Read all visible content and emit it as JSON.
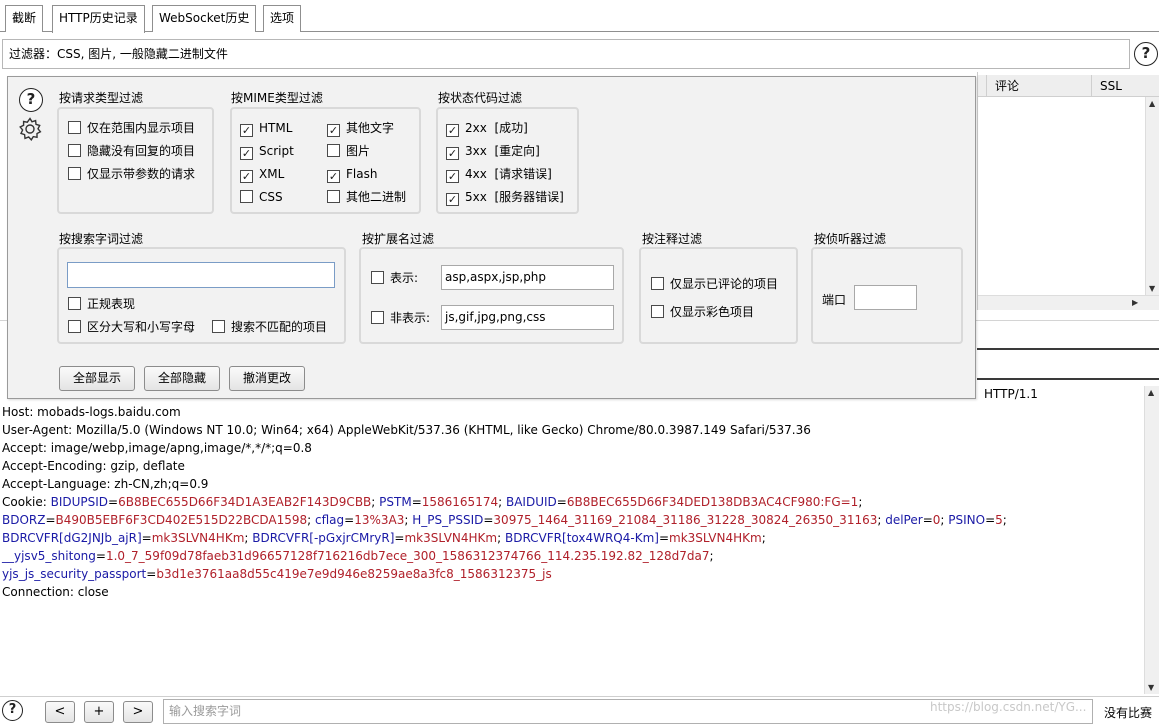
{
  "tabs": [
    "截断",
    "HTTP历史记录",
    "WebSocket历史",
    "选项"
  ],
  "filter_bar": {
    "text": "过滤器：CSS, 图片, 一般隐藏二进制文件"
  },
  "table_header": {
    "col_comment": "评论",
    "col_ssl": "SSL"
  },
  "popup": {
    "request_type": {
      "title": "按请求类型过滤",
      "options": [
        {
          "label": "仅在范围内显示项目",
          "checked": false
        },
        {
          "label": "隐藏没有回复的项目",
          "checked": false
        },
        {
          "label": "仅显示带参数的请求",
          "checked": false
        }
      ]
    },
    "mime": {
      "title": "按MIME类型过滤",
      "options": [
        {
          "label": "HTML",
          "checked": true
        },
        {
          "label": "其他文字",
          "checked": true
        },
        {
          "label": "Script",
          "checked": true
        },
        {
          "label": "图片",
          "checked": false
        },
        {
          "label": "XML",
          "checked": true
        },
        {
          "label": "Flash",
          "checked": true
        },
        {
          "label": "CSS",
          "checked": false
        },
        {
          "label": "其他二进制",
          "checked": false
        }
      ]
    },
    "status": {
      "title": "按状态代码过滤",
      "options": [
        {
          "label": "2xx  [成功]",
          "checked": true
        },
        {
          "label": "3xx  [重定向]",
          "checked": true
        },
        {
          "label": "4xx  [请求错误]",
          "checked": true
        },
        {
          "label": "5xx  [服务器错误]",
          "checked": true
        }
      ]
    },
    "search": {
      "title": "按搜索字词过滤",
      "value": "",
      "regex": {
        "label": "正规表现",
        "checked": false
      },
      "case": {
        "label": "区分大写和小写字母",
        "checked": false
      },
      "negative": {
        "label": "搜索不匹配的项目",
        "checked": false
      }
    },
    "extension": {
      "title": "按扩展名过滤",
      "show_label": "表示:",
      "show_value": "asp,aspx,jsp,php",
      "hide_label": "非表示:",
      "hide_value": "js,gif,jpg,png,css"
    },
    "annotation": {
      "title": "按注释过滤",
      "commented": {
        "label": "仅显示已评论的项目",
        "checked": false
      },
      "highlighted": {
        "label": "仅显示彩色项目",
        "checked": false
      }
    },
    "listener": {
      "title": "按侦听器过滤",
      "port_label": "端口",
      "port_value": ""
    },
    "buttons": {
      "show_all": "全部显示",
      "hide_all": "全部隐藏",
      "revert": "撤消更改"
    }
  },
  "request": {
    "first_line_tail": "HTTP/1.1",
    "lines": [
      {
        "parts": [
          {
            "t": "Host: mobads-logs.baidu.com",
            "c": "n"
          }
        ]
      },
      {
        "parts": [
          {
            "t": "User-Agent: Mozilla/5.0 (Windows NT 10.0; Win64; x64) AppleWebKit/537.36 (KHTML, like Gecko) Chrome/80.0.3987.149 Safari/537.36",
            "c": "n"
          }
        ]
      },
      {
        "parts": [
          {
            "t": "Accept: image/webp,image/apng,image/*,*/*;q=0.8",
            "c": "n"
          }
        ]
      },
      {
        "parts": [
          {
            "t": "Accept-Encoding: gzip, deflate",
            "c": "n"
          }
        ]
      },
      {
        "parts": [
          {
            "t": "Accept-Language: zh-CN,zh;q=0.9",
            "c": "n"
          }
        ]
      },
      {
        "parts": [
          {
            "t": "Cookie: ",
            "c": "n"
          },
          {
            "t": "BIDUPSID",
            "c": "k"
          },
          {
            "t": "=",
            "c": "n"
          },
          {
            "t": "6B8BEC655D66F34D1A3EAB2F143D9CBB",
            "c": "v"
          },
          {
            "t": "; ",
            "c": "n"
          },
          {
            "t": "PSTM",
            "c": "k"
          },
          {
            "t": "=",
            "c": "n"
          },
          {
            "t": "1586165174",
            "c": "v"
          },
          {
            "t": "; ",
            "c": "n"
          },
          {
            "t": "BAIDUID",
            "c": "k"
          },
          {
            "t": "=",
            "c": "n"
          },
          {
            "t": "6B8BEC655D66F34DED138DB3AC4CF980:FG=1",
            "c": "v"
          },
          {
            "t": ";",
            "c": "n"
          }
        ]
      },
      {
        "parts": [
          {
            "t": "BDORZ",
            "c": "k"
          },
          {
            "t": "=",
            "c": "n"
          },
          {
            "t": "B490B5EBF6F3CD402E515D22BCDA1598",
            "c": "v"
          },
          {
            "t": "; ",
            "c": "n"
          },
          {
            "t": "cflag",
            "c": "k"
          },
          {
            "t": "=",
            "c": "n"
          },
          {
            "t": "13%3A3",
            "c": "v"
          },
          {
            "t": "; ",
            "c": "n"
          },
          {
            "t": "H_PS_PSSID",
            "c": "k"
          },
          {
            "t": "=",
            "c": "n"
          },
          {
            "t": "30975_1464_31169_21084_31186_31228_30824_26350_31163",
            "c": "v"
          },
          {
            "t": "; ",
            "c": "n"
          },
          {
            "t": "delPer",
            "c": "k"
          },
          {
            "t": "=",
            "c": "n"
          },
          {
            "t": "0",
            "c": "v"
          },
          {
            "t": "; ",
            "c": "n"
          },
          {
            "t": "PSINO",
            "c": "k"
          },
          {
            "t": "=",
            "c": "n"
          },
          {
            "t": "5",
            "c": "v"
          },
          {
            "t": ";",
            "c": "n"
          }
        ]
      },
      {
        "parts": [
          {
            "t": "BDRCVFR[dG2JNJb_ajR]",
            "c": "k"
          },
          {
            "t": "=",
            "c": "n"
          },
          {
            "t": "mk3SLVN4HKm",
            "c": "v"
          },
          {
            "t": "; ",
            "c": "n"
          },
          {
            "t": "BDRCVFR[-pGxjrCMryR]",
            "c": "k"
          },
          {
            "t": "=",
            "c": "n"
          },
          {
            "t": "mk3SLVN4HKm",
            "c": "v"
          },
          {
            "t": "; ",
            "c": "n"
          },
          {
            "t": "BDRCVFR[tox4WRQ4-Km]",
            "c": "k"
          },
          {
            "t": "=",
            "c": "n"
          },
          {
            "t": "mk3SLVN4HKm",
            "c": "v"
          },
          {
            "t": ";",
            "c": "n"
          }
        ]
      },
      {
        "parts": [
          {
            "t": "__yjsv5_shitong",
            "c": "k"
          },
          {
            "t": "=",
            "c": "n"
          },
          {
            "t": "1.0_7_59f09d78faeb31d96657128f716216db7ece_300_1586312374766_114.235.192.82_128d7da7",
            "c": "v"
          },
          {
            "t": ";",
            "c": "n"
          }
        ]
      },
      {
        "parts": [
          {
            "t": "yjs_js_security_passport",
            "c": "k"
          },
          {
            "t": "=",
            "c": "n"
          },
          {
            "t": "b3d1e3761aa8d55c419e7e9d946e8259ae8a3fc8_1586312375_js",
            "c": "v"
          }
        ]
      },
      {
        "parts": [
          {
            "t": "Connection: close",
            "c": "n"
          }
        ]
      }
    ]
  },
  "bottom": {
    "prev": "<",
    "add": "+",
    "next": ">",
    "search_placeholder": "输入搜索字词",
    "matches": "没有比赛",
    "watermark": "https://blog.csdn.net/YG..."
  }
}
